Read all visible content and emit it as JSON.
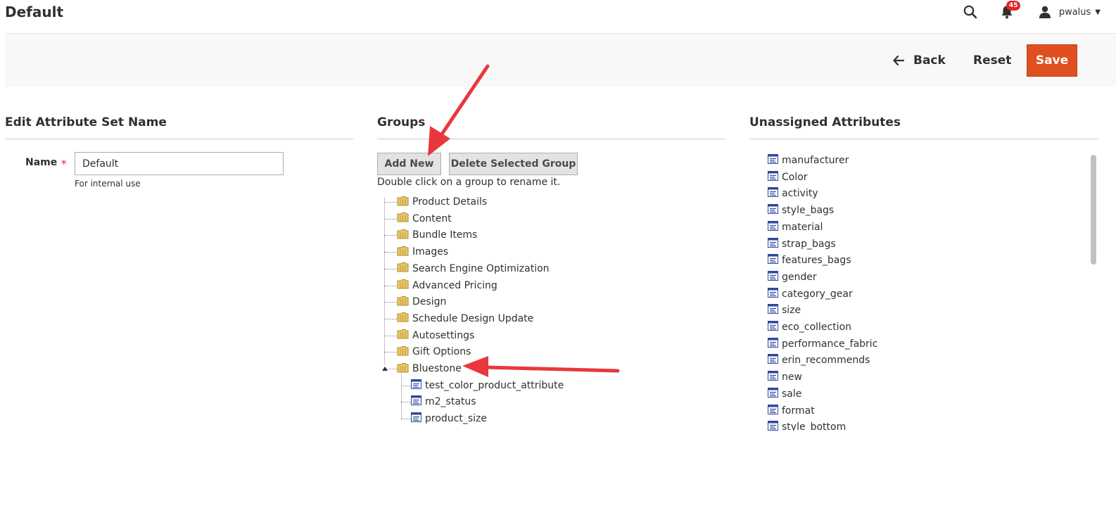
{
  "header": {
    "title": "Default",
    "notifications_count": "45",
    "username": "pwalus"
  },
  "actions": {
    "back_label": "Back",
    "reset_label": "Reset",
    "save_label": "Save"
  },
  "edit_name": {
    "section_title": "Edit Attribute Set Name",
    "label": "Name",
    "value": "Default",
    "note": "For internal use"
  },
  "groups": {
    "section_title": "Groups",
    "add_new_label": "Add New",
    "delete_label": "Delete Selected Group",
    "hint": "Double click on a group to rename it.",
    "items": [
      {
        "label": "Product Details"
      },
      {
        "label": "Content"
      },
      {
        "label": "Bundle Items"
      },
      {
        "label": "Images"
      },
      {
        "label": "Search Engine Optimization"
      },
      {
        "label": "Advanced Pricing"
      },
      {
        "label": "Design"
      },
      {
        "label": "Schedule Design Update"
      },
      {
        "label": "Autosettings"
      },
      {
        "label": "Gift Options"
      },
      {
        "label": "Bluestone",
        "expanded": true,
        "children": [
          "test_color_product_attribute",
          "m2_status",
          "product_size"
        ]
      }
    ]
  },
  "unassigned": {
    "section_title": "Unassigned Attributes",
    "items": [
      "manufacturer",
      "Color",
      "activity",
      "style_bags",
      "material",
      "strap_bags",
      "features_bags",
      "gender",
      "category_gear",
      "size",
      "eco_collection",
      "performance_fabric",
      "erin_recommends",
      "new",
      "sale",
      "format",
      "style_bottom"
    ]
  },
  "colors": {
    "accent": "#e04f1f",
    "arrow": "#e8383d",
    "badge": "#e22626"
  }
}
